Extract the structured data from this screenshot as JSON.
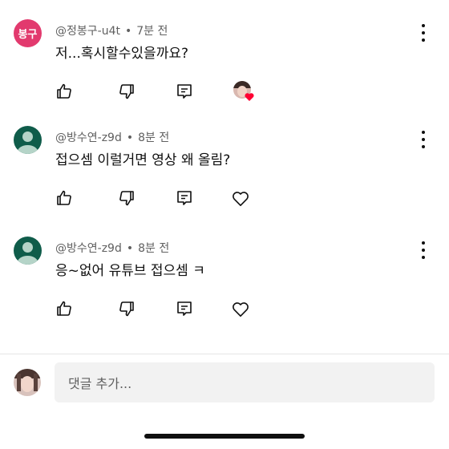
{
  "comments": [
    {
      "avatar_text": "봉구",
      "author": "@정봉구-u4t",
      "time": "7분 전",
      "text": "저...혹시할수있을까요?",
      "liked_by_creator": true
    },
    {
      "avatar_text": "",
      "author": "@방수연-z9d",
      "time": "8분 전",
      "text": "접으셈 이럴거면 영상 왜 올림?",
      "liked_by_creator": false
    },
    {
      "avatar_text": "",
      "author": "@방수연-z9d",
      "time": "8분 전",
      "text": "응~없어 유튜브 접으셈 ㅋ",
      "liked_by_creator": false
    }
  ],
  "compose": {
    "placeholder": "댓글 추가..."
  },
  "colors": {
    "creator_heart": "#ff0033",
    "avatar_pink": "#e23a6e",
    "avatar_green": "#0f5c4a"
  },
  "icons": [
    "thumbs-up-icon",
    "thumbs-down-icon",
    "reply-icon",
    "heart-icon",
    "more-vert-icon"
  ]
}
